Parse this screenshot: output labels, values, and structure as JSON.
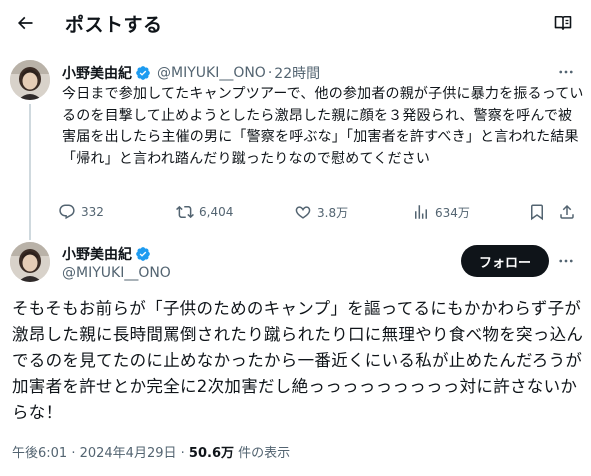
{
  "header": {
    "title": "ポストする"
  },
  "reply_post": {
    "display_name": "小野美由紀",
    "handle": "@MIYUKI__ONO",
    "separator": "·",
    "time": "22時間",
    "text": "今日まで参加してたキャンプツアーで、他の参加者の親が子供に暴力を振るっているのを目撃して止めようとしたら激昂した親に顔を３発殴られ、警察を呼んで被害届を出したら主催の男に「警察を呼ぶな」「加害者を許すべき」と言われた結果「帰れ」と言われ踏んだり蹴ったりなので慰めてください",
    "stats": {
      "replies": "332",
      "reposts": "6,404",
      "likes": "3.8万",
      "views": "634万"
    }
  },
  "main_post": {
    "display_name": "小野美由紀",
    "handle": "@MIYUKI__ONO",
    "follow_label": "フォロー",
    "text": "そもそもお前らが「子供のためのキャンプ」を謳ってるにもかかわらず子が激昂した親に長時間罵倒されたり蹴られたり口に無理やり食べ物を突っ込んでるのを見てたのに止めなかったから一番近くにいる私が止めたんだろうが　加害者を許せとか完全に2次加害だし絶っっっっっっっっっ対に許さないからな！",
    "timestamp": "午後6:01 · 2024年4月29日",
    "footer_separator": "·",
    "views_count": "50.6万",
    "views_label": "件の表示"
  },
  "colors": {
    "text_primary": "#0f1419",
    "text_secondary": "#536471",
    "verified_blue": "#1d9bf0",
    "thread_line": "#cfd9de",
    "follow_bg": "#0f1419"
  },
  "icons": {
    "back": "arrow-left-icon",
    "reader": "reader-mode-icon",
    "verified": "verified-badge-icon",
    "more": "more-horizontal-icon",
    "reply": "reply-icon",
    "repost": "repost-icon",
    "like": "heart-icon",
    "views": "views-chart-icon",
    "bookmark": "bookmark-icon",
    "share": "share-icon"
  }
}
